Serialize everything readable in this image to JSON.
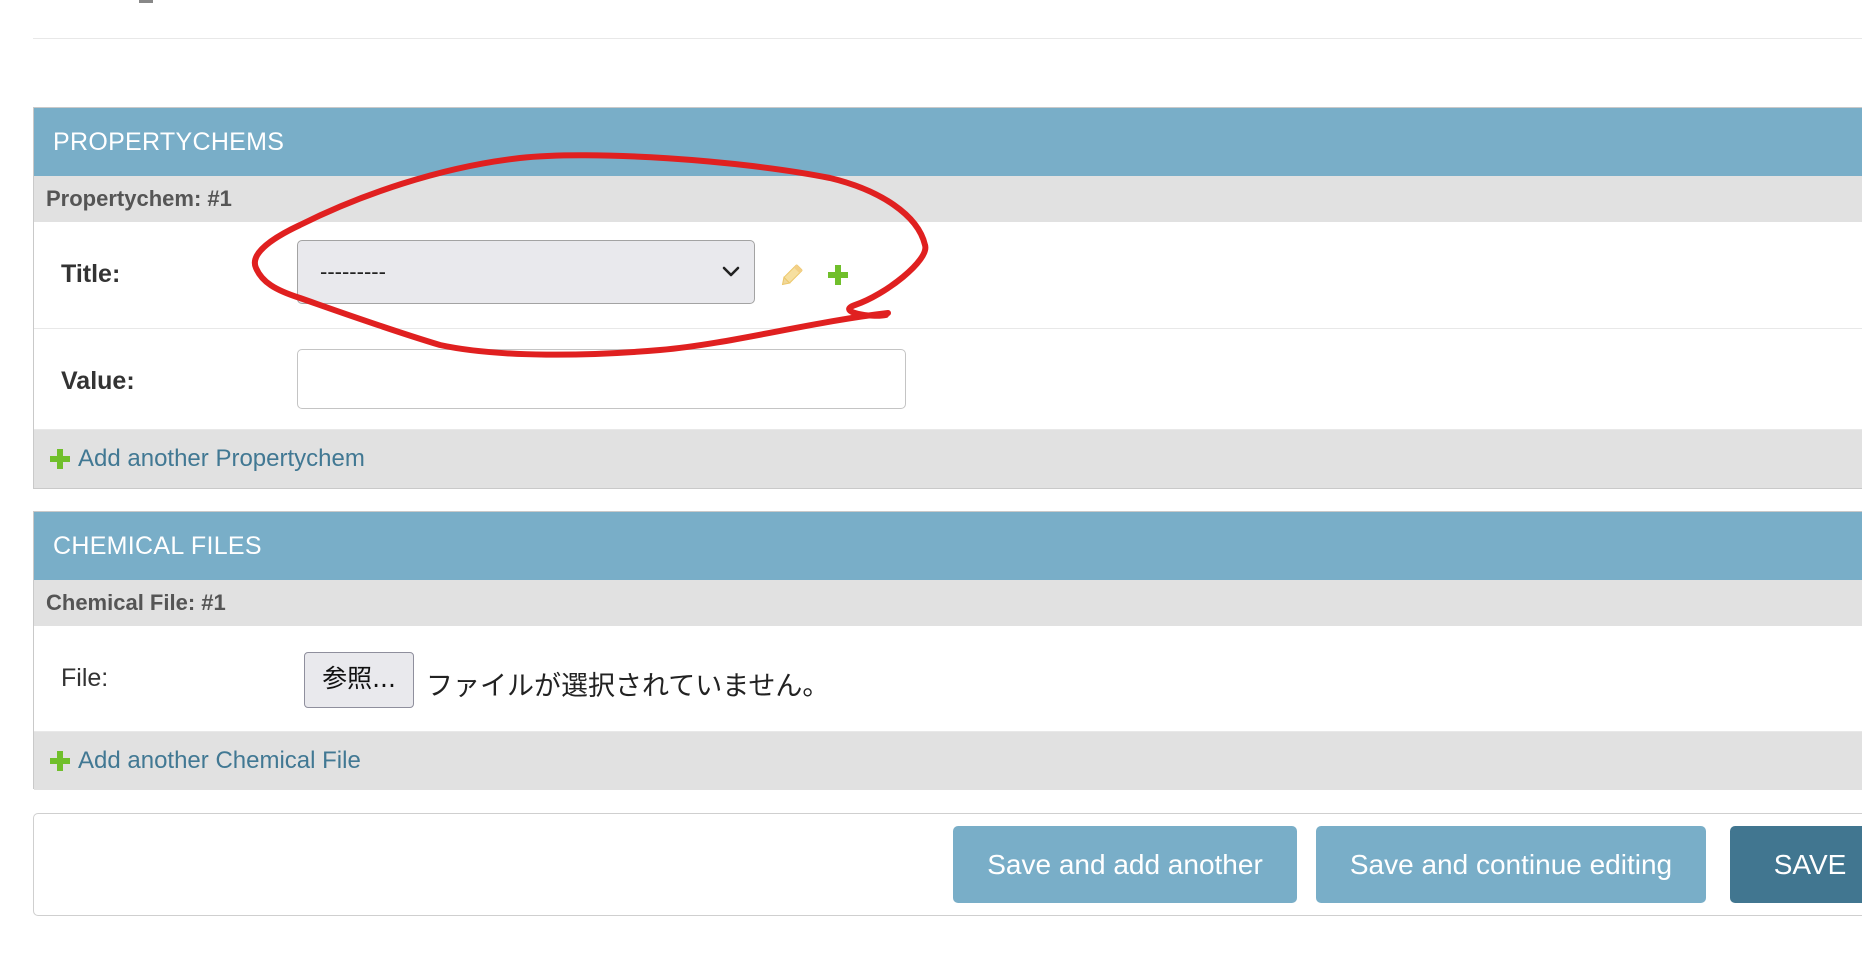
{
  "propertychems": {
    "header": "PROPERTYCHEMS",
    "inline_label": "Propertychem: #1",
    "title_label": "Title:",
    "title_select_value": "---------",
    "value_label": "Value:",
    "value_input": "",
    "add_link": "Add another Propertychem"
  },
  "chemical_files": {
    "header": "CHEMICAL FILES",
    "inline_label": "Chemical File: #1",
    "file_label": "File:",
    "browse_button": "参照...",
    "file_status": "ファイルが選択されていません。",
    "add_link": "Add another Chemical File"
  },
  "submit": {
    "save_add_another": "Save and add another",
    "save_continue": "Save and continue editing",
    "save": "SAVE"
  },
  "icons": {
    "select_arrow": "chevron-down-icon",
    "edit": "pencil-icon",
    "add": "plus-icon"
  },
  "colors": {
    "header_bg": "#79aec8",
    "link": "#417893",
    "add_green": "#70bf2b",
    "save_dark": "#417690",
    "annotation_red": "#e02020"
  }
}
